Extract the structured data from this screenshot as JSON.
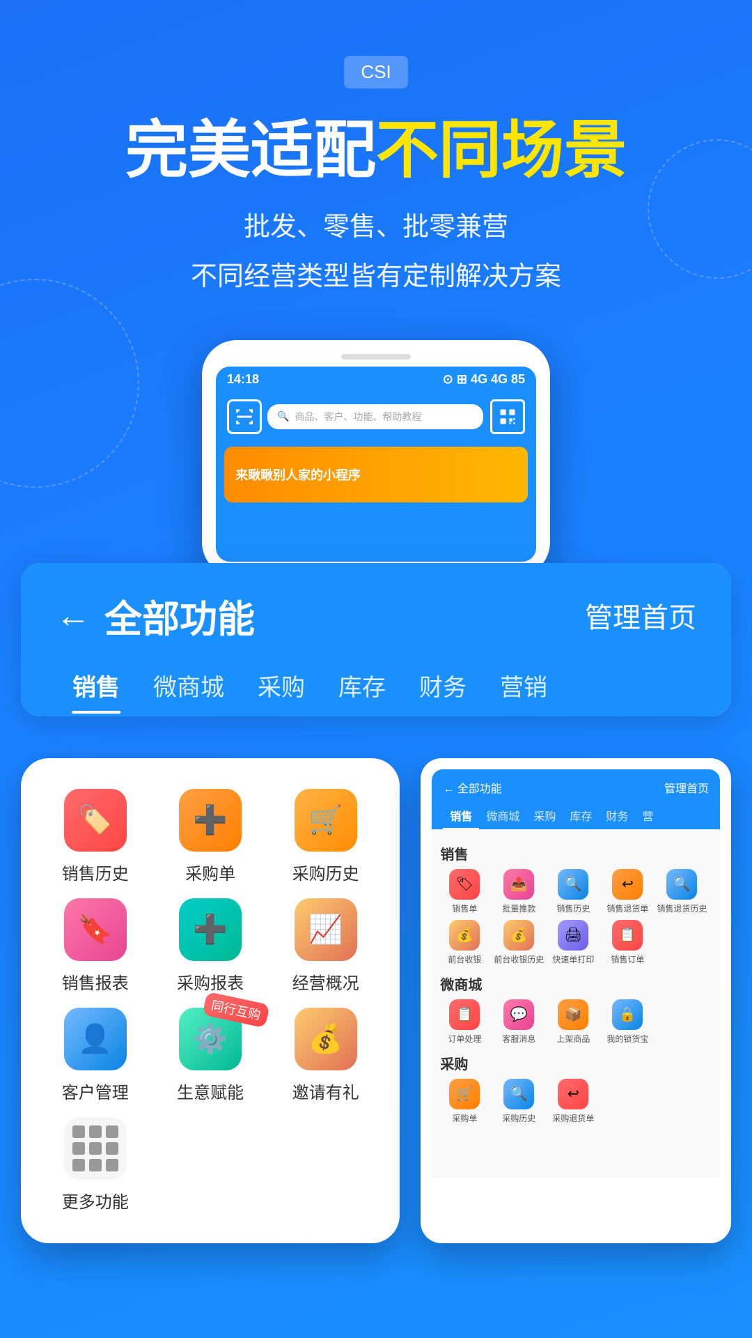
{
  "app": {
    "bg_color": "#1a7fff"
  },
  "hero": {
    "tag": "CSI",
    "title_white": "完美适配",
    "title_yellow": "不同场景",
    "subtitle1": "批发、零售、批零兼营",
    "subtitle2": "不同经营类型皆有定制解决方案"
  },
  "phone_screen": {
    "time": "14:18",
    "search_placeholder": "商品、客户、功能、帮助教程",
    "banner_text": "来瞅瞅别人家的小程序"
  },
  "function_card": {
    "back_label": "←",
    "title": "全部功能",
    "manage_home": "管理首页",
    "tabs": [
      "销售",
      "微商城",
      "采购",
      "库存",
      "财务",
      "营销"
    ]
  },
  "icon_grid_left": [
    {
      "label": "销售历史",
      "icon": "🏷",
      "color": "ic-red"
    },
    {
      "label": "采购单",
      "icon": "➕",
      "color": "ic-orange"
    },
    {
      "label": "采购历史",
      "icon": "🛒",
      "color": "ic-orange"
    },
    {
      "label": "销售报表",
      "icon": "🔖",
      "color": "ic-pink"
    },
    {
      "label": "采购报表",
      "icon": "➕",
      "color": "ic-green"
    },
    {
      "label": "经营概况",
      "icon": "📈",
      "color": "ic-yellow"
    },
    {
      "label": "客户管理",
      "icon": "👤",
      "color": "ic-blue"
    },
    {
      "label": "生意赋能",
      "icon": "⚙",
      "color": "ic-teal"
    },
    {
      "label": "邀请有礼",
      "icon": "💰",
      "color": "ic-yellow"
    },
    {
      "label": "更多功能",
      "icon": "grid",
      "color": "ic-gray"
    }
  ],
  "mini_phone": {
    "header_left": "← 全部功能",
    "header_right": "管理首页",
    "tabs": [
      "销售",
      "微商城",
      "采购",
      "库存",
      "财务",
      "营"
    ],
    "sections": [
      {
        "title": "销售",
        "icons": [
          {
            "label": "销售单",
            "icon": "🏷"
          },
          {
            "label": "批量推款",
            "icon": "📤"
          },
          {
            "label": "销售历史",
            "icon": "🔍"
          },
          {
            "label": "销售退货单",
            "icon": "↩"
          },
          {
            "label": "销售退货历史",
            "icon": "🔍"
          },
          {
            "label": "前台收银",
            "icon": "💰"
          },
          {
            "label": "前台收银历史",
            "icon": "💰"
          },
          {
            "label": "快速单打印",
            "icon": "🖨"
          },
          {
            "label": "销售订单",
            "icon": "📋"
          }
        ]
      },
      {
        "title": "微商城",
        "icons": [
          {
            "label": "订单处理",
            "icon": "📋"
          },
          {
            "label": "客服消息",
            "icon": "💬"
          },
          {
            "label": "上架商品",
            "icon": "📦"
          },
          {
            "label": "我的锁货宝",
            "icon": "🔒"
          }
        ]
      },
      {
        "title": "采购",
        "icons": [
          {
            "label": "采购单",
            "icon": "🛒"
          },
          {
            "label": "采购历史",
            "icon": "🔍"
          },
          {
            "label": "采购退货单",
            "icon": "↩"
          }
        ]
      }
    ]
  }
}
